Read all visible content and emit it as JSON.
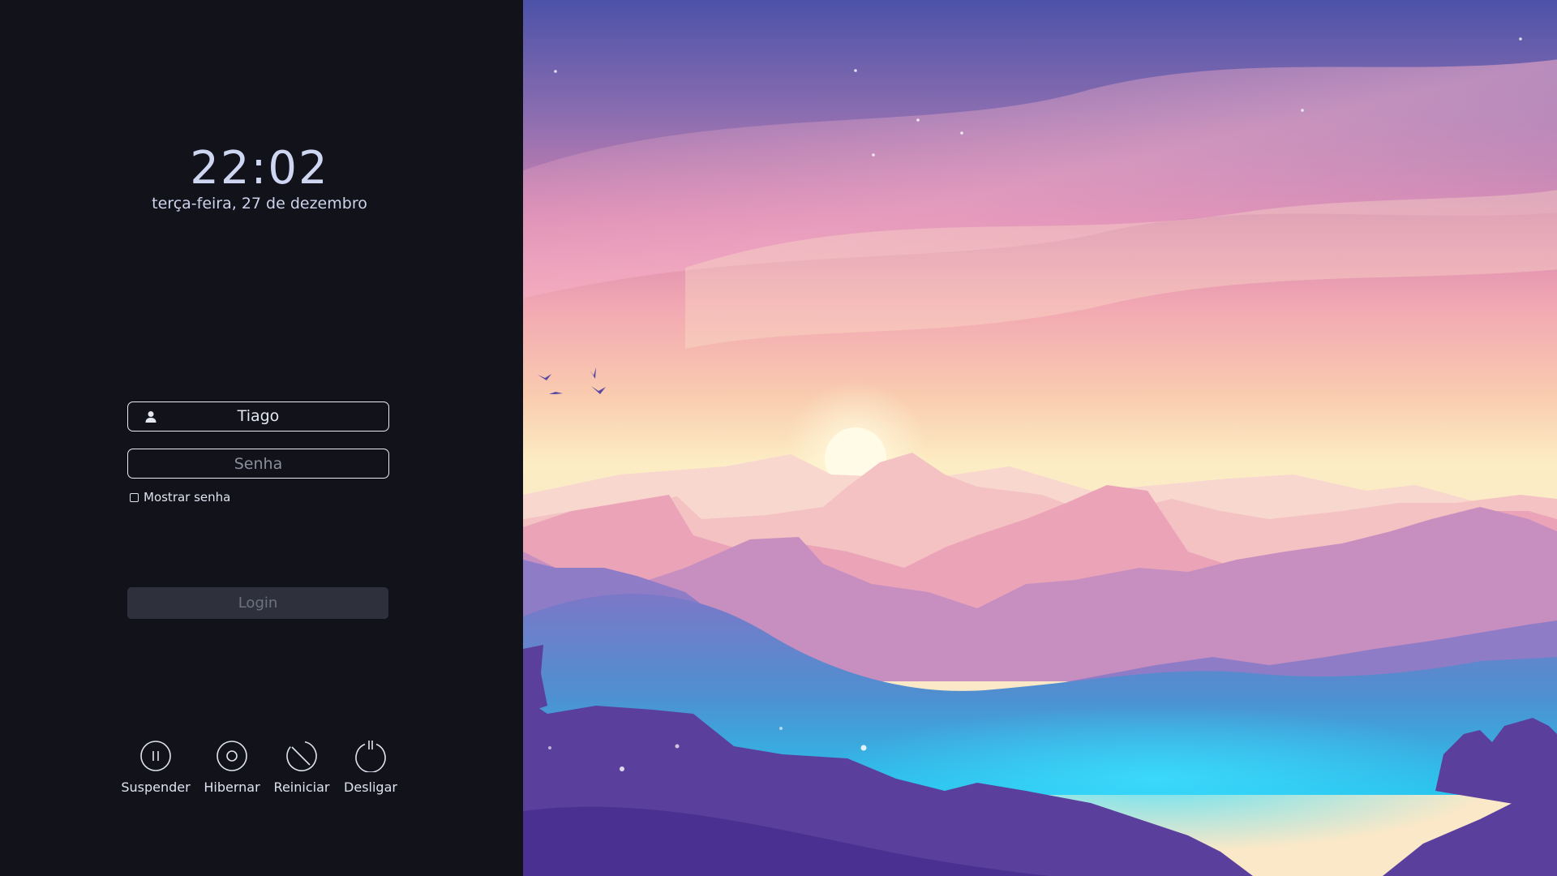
{
  "clock": {
    "time": "22:02",
    "date": "terça-feira, 27 de dezembro"
  },
  "login": {
    "username": "Tiago",
    "password_placeholder": "Senha",
    "show_password_label": "Mostrar senha",
    "login_label": "Login"
  },
  "power": {
    "suspend_label": "Suspender",
    "hibernate_label": "Hibernar",
    "restart_label": "Reiniciar",
    "shutdown_label": "Desligar"
  },
  "icons": {
    "user": "user-icon",
    "suspend": "pause-circle-icon",
    "hibernate": "hibernate-circle-icon",
    "restart": "restart-icon",
    "shutdown": "power-icon"
  },
  "colors": {
    "panel_bg": "#12121b",
    "text": "#e2e6f4",
    "login_button_bg": "#2e303c",
    "login_button_text": "#6e7180"
  }
}
